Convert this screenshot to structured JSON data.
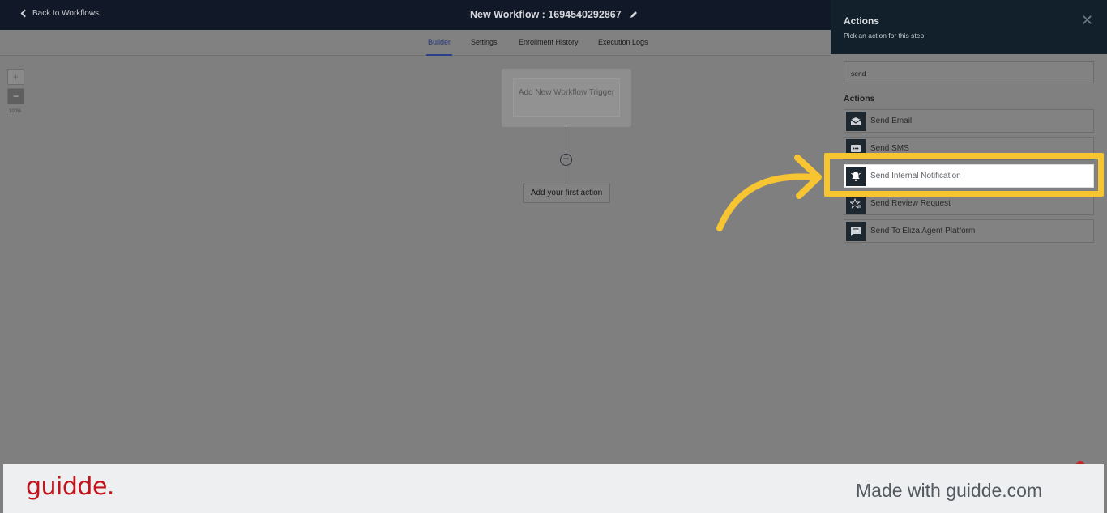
{
  "header": {
    "back_label": "Back to Workflows",
    "workflow_title": "New Workflow : 1694540292867"
  },
  "tabs": [
    {
      "label": "Builder",
      "active": true
    },
    {
      "label": "Settings",
      "active": false
    },
    {
      "label": "Enrollment History",
      "active": false
    },
    {
      "label": "Execution Logs",
      "active": false
    }
  ],
  "canvas": {
    "zoom_in": "+",
    "zoom_out": "−",
    "zoom_level": "100%",
    "trigger_label": "Add New Workflow Trigger",
    "add_step": "+",
    "first_action_label": "Add your first action"
  },
  "panel": {
    "title": "Actions",
    "subtitle": "Pick an action for this step",
    "close": "✕",
    "search_value": "send",
    "section_label": "Actions",
    "actions": [
      {
        "label": "Send Email",
        "icon": "email-icon"
      },
      {
        "label": "Send SMS",
        "icon": "sms-icon"
      },
      {
        "label": "Send Internal Notification",
        "icon": "bell-icon",
        "highlighted": true
      },
      {
        "label": "Send Review Request",
        "icon": "star-icon"
      },
      {
        "label": "Send To Eliza Agent Platform",
        "icon": "chat-icon"
      }
    ]
  },
  "footer": {
    "brand": "guidde.",
    "made_with": "Made with guidde.com"
  },
  "colors": {
    "highlight": "#f7c531",
    "brand": "#c1141c",
    "topbar": "#111827"
  }
}
